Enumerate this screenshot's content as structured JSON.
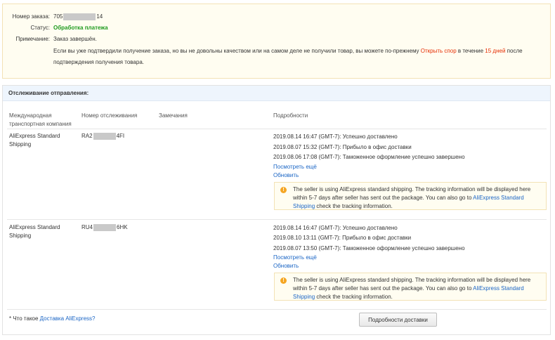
{
  "order": {
    "number_label": "Номер заказа:",
    "number_prefix": "705",
    "number_suffix": "14",
    "status_label": "Статус:",
    "status_value": "Обработка платежа",
    "note_label": "Примечание:",
    "note_value": "Заказ завершён.",
    "note_line1_a": "Если вы уже подтвердили получение заказа, но вы не довольны качеством или на самом деле не получили товар, вы можете по-прежнему",
    "dispute_link": "Открыть спор",
    "note_line1_b": "в течение",
    "days": "15 дней",
    "note_line1_c": "после",
    "note_line2": "подтверждения получения товара."
  },
  "tracking": {
    "header": "Отслеживание отправления:",
    "columns": {
      "carrier": "Международная транспортная компания",
      "tracking_number": "Номер отслеживания",
      "remarks": "Замечания",
      "details": "Подробности"
    },
    "shipments": [
      {
        "carrier": "AliExpress Standard Shipping",
        "tracking_prefix": "RA2",
        "tracking_suffix": "4FI",
        "events": [
          "2019.08.14 16:47 (GMT-7): Успешно доставлено",
          "2019.08.07 15:32 (GMT-7): Прибыло в офис доставки",
          "2019.08.06 17:08 (GMT-7): Таможенное оформление успешно завершено"
        ],
        "more_link": "Посмотреть ещё",
        "refresh_link": "Обновить"
      },
      {
        "carrier": "AliExpress Standard Shipping",
        "tracking_prefix": "RU4",
        "tracking_suffix": "6HK",
        "events": [
          "2019.08.14 16:47 (GMT-7): Успешно доставлено",
          "2019.08.10 13:11 (GMT-7): Прибыло в офис доставки",
          "2019.08.07 13:50 (GMT-7): Таможенное оформление успешно завершено"
        ],
        "more_link": "Посмотреть ещё",
        "refresh_link": "Обновить"
      }
    ],
    "notice": {
      "text_a": "The seller is using AliExpress standard shipping. The tracking information will be displayed here within 5-7 days after seller has sent out the package. You can also go to",
      "link": "AliExpress Standard Shipping",
      "text_b": "check the tracking information.",
      "icon": "info-icon"
    },
    "footer_text": "* Что такое",
    "footer_link": "Доставка AliExpress?",
    "details_button": "Подробности доставки"
  }
}
